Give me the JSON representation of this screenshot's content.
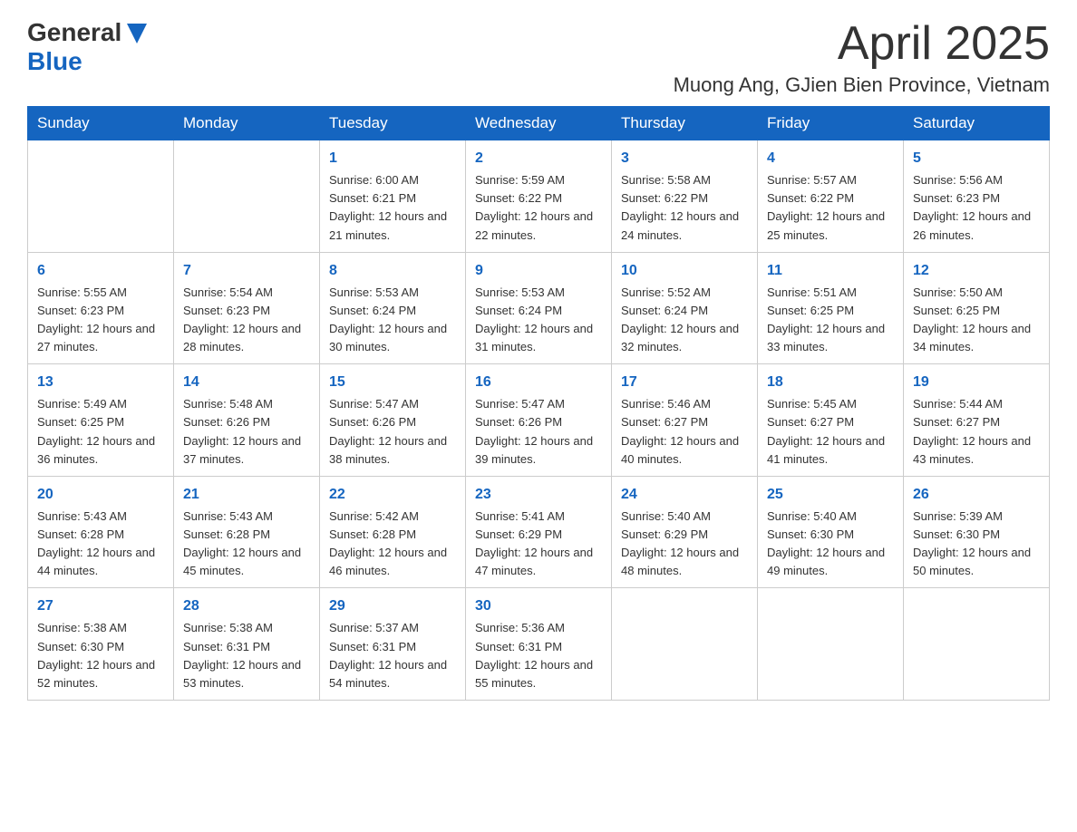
{
  "header": {
    "logo_general": "General",
    "logo_blue": "Blue",
    "month": "April 2025",
    "location": "Muong Ang, GJien Bien Province, Vietnam"
  },
  "weekdays": [
    "Sunday",
    "Monday",
    "Tuesday",
    "Wednesday",
    "Thursday",
    "Friday",
    "Saturday"
  ],
  "weeks": [
    [
      {
        "day": "",
        "sunrise": "",
        "sunset": "",
        "daylight": ""
      },
      {
        "day": "",
        "sunrise": "",
        "sunset": "",
        "daylight": ""
      },
      {
        "day": "1",
        "sunrise": "Sunrise: 6:00 AM",
        "sunset": "Sunset: 6:21 PM",
        "daylight": "Daylight: 12 hours and 21 minutes."
      },
      {
        "day": "2",
        "sunrise": "Sunrise: 5:59 AM",
        "sunset": "Sunset: 6:22 PM",
        "daylight": "Daylight: 12 hours and 22 minutes."
      },
      {
        "day": "3",
        "sunrise": "Sunrise: 5:58 AM",
        "sunset": "Sunset: 6:22 PM",
        "daylight": "Daylight: 12 hours and 24 minutes."
      },
      {
        "day": "4",
        "sunrise": "Sunrise: 5:57 AM",
        "sunset": "Sunset: 6:22 PM",
        "daylight": "Daylight: 12 hours and 25 minutes."
      },
      {
        "day": "5",
        "sunrise": "Sunrise: 5:56 AM",
        "sunset": "Sunset: 6:23 PM",
        "daylight": "Daylight: 12 hours and 26 minutes."
      }
    ],
    [
      {
        "day": "6",
        "sunrise": "Sunrise: 5:55 AM",
        "sunset": "Sunset: 6:23 PM",
        "daylight": "Daylight: 12 hours and 27 minutes."
      },
      {
        "day": "7",
        "sunrise": "Sunrise: 5:54 AM",
        "sunset": "Sunset: 6:23 PM",
        "daylight": "Daylight: 12 hours and 28 minutes."
      },
      {
        "day": "8",
        "sunrise": "Sunrise: 5:53 AM",
        "sunset": "Sunset: 6:24 PM",
        "daylight": "Daylight: 12 hours and 30 minutes."
      },
      {
        "day": "9",
        "sunrise": "Sunrise: 5:53 AM",
        "sunset": "Sunset: 6:24 PM",
        "daylight": "Daylight: 12 hours and 31 minutes."
      },
      {
        "day": "10",
        "sunrise": "Sunrise: 5:52 AM",
        "sunset": "Sunset: 6:24 PM",
        "daylight": "Daylight: 12 hours and 32 minutes."
      },
      {
        "day": "11",
        "sunrise": "Sunrise: 5:51 AM",
        "sunset": "Sunset: 6:25 PM",
        "daylight": "Daylight: 12 hours and 33 minutes."
      },
      {
        "day": "12",
        "sunrise": "Sunrise: 5:50 AM",
        "sunset": "Sunset: 6:25 PM",
        "daylight": "Daylight: 12 hours and 34 minutes."
      }
    ],
    [
      {
        "day": "13",
        "sunrise": "Sunrise: 5:49 AM",
        "sunset": "Sunset: 6:25 PM",
        "daylight": "Daylight: 12 hours and 36 minutes."
      },
      {
        "day": "14",
        "sunrise": "Sunrise: 5:48 AM",
        "sunset": "Sunset: 6:26 PM",
        "daylight": "Daylight: 12 hours and 37 minutes."
      },
      {
        "day": "15",
        "sunrise": "Sunrise: 5:47 AM",
        "sunset": "Sunset: 6:26 PM",
        "daylight": "Daylight: 12 hours and 38 minutes."
      },
      {
        "day": "16",
        "sunrise": "Sunrise: 5:47 AM",
        "sunset": "Sunset: 6:26 PM",
        "daylight": "Daylight: 12 hours and 39 minutes."
      },
      {
        "day": "17",
        "sunrise": "Sunrise: 5:46 AM",
        "sunset": "Sunset: 6:27 PM",
        "daylight": "Daylight: 12 hours and 40 minutes."
      },
      {
        "day": "18",
        "sunrise": "Sunrise: 5:45 AM",
        "sunset": "Sunset: 6:27 PM",
        "daylight": "Daylight: 12 hours and 41 minutes."
      },
      {
        "day": "19",
        "sunrise": "Sunrise: 5:44 AM",
        "sunset": "Sunset: 6:27 PM",
        "daylight": "Daylight: 12 hours and 43 minutes."
      }
    ],
    [
      {
        "day": "20",
        "sunrise": "Sunrise: 5:43 AM",
        "sunset": "Sunset: 6:28 PM",
        "daylight": "Daylight: 12 hours and 44 minutes."
      },
      {
        "day": "21",
        "sunrise": "Sunrise: 5:43 AM",
        "sunset": "Sunset: 6:28 PM",
        "daylight": "Daylight: 12 hours and 45 minutes."
      },
      {
        "day": "22",
        "sunrise": "Sunrise: 5:42 AM",
        "sunset": "Sunset: 6:28 PM",
        "daylight": "Daylight: 12 hours and 46 minutes."
      },
      {
        "day": "23",
        "sunrise": "Sunrise: 5:41 AM",
        "sunset": "Sunset: 6:29 PM",
        "daylight": "Daylight: 12 hours and 47 minutes."
      },
      {
        "day": "24",
        "sunrise": "Sunrise: 5:40 AM",
        "sunset": "Sunset: 6:29 PM",
        "daylight": "Daylight: 12 hours and 48 minutes."
      },
      {
        "day": "25",
        "sunrise": "Sunrise: 5:40 AM",
        "sunset": "Sunset: 6:30 PM",
        "daylight": "Daylight: 12 hours and 49 minutes."
      },
      {
        "day": "26",
        "sunrise": "Sunrise: 5:39 AM",
        "sunset": "Sunset: 6:30 PM",
        "daylight": "Daylight: 12 hours and 50 minutes."
      }
    ],
    [
      {
        "day": "27",
        "sunrise": "Sunrise: 5:38 AM",
        "sunset": "Sunset: 6:30 PM",
        "daylight": "Daylight: 12 hours and 52 minutes."
      },
      {
        "day": "28",
        "sunrise": "Sunrise: 5:38 AM",
        "sunset": "Sunset: 6:31 PM",
        "daylight": "Daylight: 12 hours and 53 minutes."
      },
      {
        "day": "29",
        "sunrise": "Sunrise: 5:37 AM",
        "sunset": "Sunset: 6:31 PM",
        "daylight": "Daylight: 12 hours and 54 minutes."
      },
      {
        "day": "30",
        "sunrise": "Sunrise: 5:36 AM",
        "sunset": "Sunset: 6:31 PM",
        "daylight": "Daylight: 12 hours and 55 minutes."
      },
      {
        "day": "",
        "sunrise": "",
        "sunset": "",
        "daylight": ""
      },
      {
        "day": "",
        "sunrise": "",
        "sunset": "",
        "daylight": ""
      },
      {
        "day": "",
        "sunrise": "",
        "sunset": "",
        "daylight": ""
      }
    ]
  ]
}
